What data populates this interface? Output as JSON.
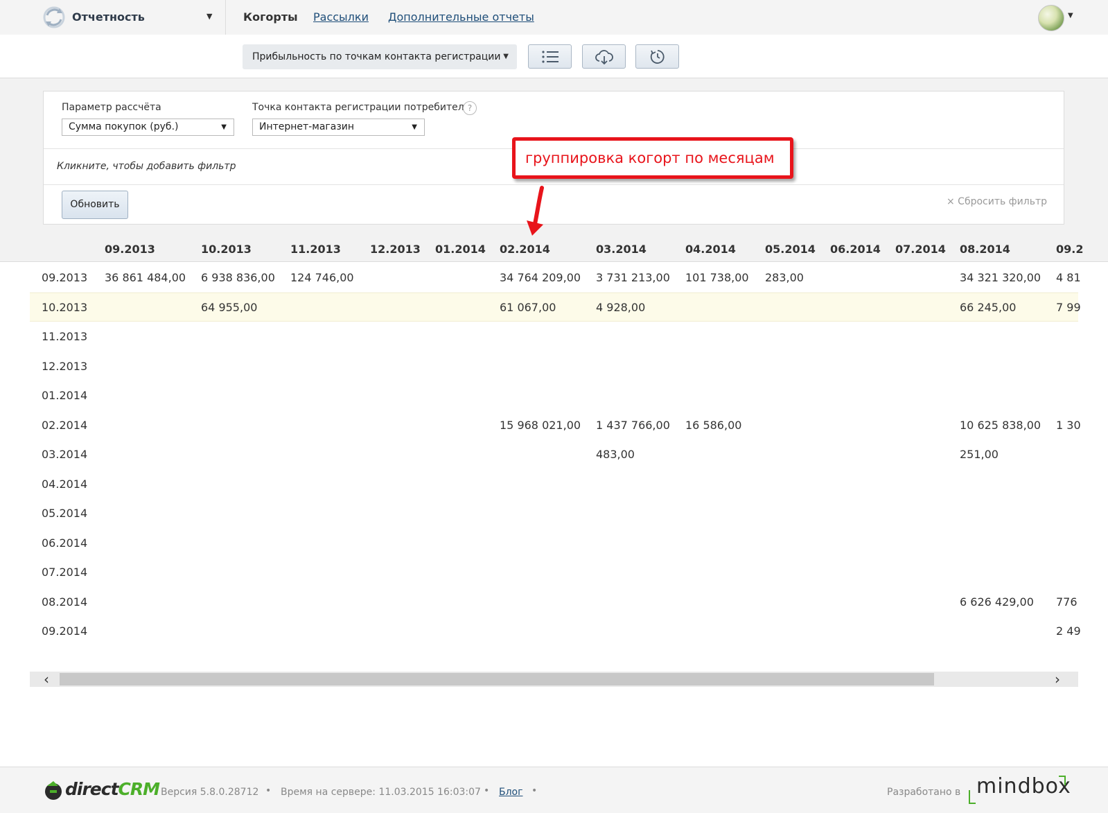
{
  "nav": {
    "section_title": "Отчетность",
    "active_tab": "Когорты",
    "links": [
      "Рассылки",
      "Дополнительные отчеты"
    ]
  },
  "toolbar": {
    "report_select": "Прибыльность по точкам контакта регистрации",
    "buttons": [
      "list-icon",
      "cloud-download-icon",
      "history-icon"
    ]
  },
  "filters": {
    "param_label": "Параметр рассчёта",
    "param_value": "Сумма покупок (руб.)",
    "point_label": "Точка контакта регистрации потребителя",
    "point_value": "Интернет-магазин",
    "help": "?",
    "add_filter": "Кликните, чтобы добавить фильтр",
    "update_label": "Обновить",
    "reset_label": "× Сбросить фильтр"
  },
  "annotation": {
    "text": "группировка когорт по месяцам",
    "color": "#e8141b"
  },
  "table": {
    "columns": [
      "09.2013",
      "10.2013",
      "11.2013",
      "12.2013",
      "01.2014",
      "02.2014",
      "03.2014",
      "04.2014",
      "05.2014",
      "06.2014",
      "07.2014",
      "08.2014",
      "09.2"
    ],
    "rows": [
      {
        "label": "09.2013",
        "cells": [
          "36 861 484,00",
          "6 938 836,00",
          "124 746,00",
          "",
          "",
          "34 764 209,00",
          "3 731 213,00",
          "101 738,00",
          "283,00",
          "",
          "",
          "34 321 320,00",
          "4 81"
        ]
      },
      {
        "label": "10.2013",
        "cells": [
          "",
          "64 955,00",
          "",
          "",
          "",
          "61 067,00",
          "4 928,00",
          "",
          "",
          "",
          "",
          "66 245,00",
          "7 99"
        ]
      },
      {
        "label": "11.2013",
        "cells": [
          "",
          "",
          "",
          "",
          "",
          "",
          "",
          "",
          "",
          "",
          "",
          "",
          ""
        ]
      },
      {
        "label": "12.2013",
        "cells": [
          "",
          "",
          "",
          "",
          "",
          "",
          "",
          "",
          "",
          "",
          "",
          "",
          ""
        ]
      },
      {
        "label": "01.2014",
        "cells": [
          "",
          "",
          "",
          "",
          "",
          "",
          "",
          "",
          "",
          "",
          "",
          "",
          ""
        ]
      },
      {
        "label": "02.2014",
        "cells": [
          "",
          "",
          "",
          "",
          "",
          "15 968 021,00",
          "1 437 766,00",
          "16 586,00",
          "",
          "",
          "",
          "10 625 838,00",
          "1 30"
        ]
      },
      {
        "label": "03.2014",
        "cells": [
          "",
          "",
          "",
          "",
          "",
          "",
          "483,00",
          "",
          "",
          "",
          "",
          "251,00",
          ""
        ]
      },
      {
        "label": "04.2014",
        "cells": [
          "",
          "",
          "",
          "",
          "",
          "",
          "",
          "",
          "",
          "",
          "",
          "",
          ""
        ]
      },
      {
        "label": "05.2014",
        "cells": [
          "",
          "",
          "",
          "",
          "",
          "",
          "",
          "",
          "",
          "",
          "",
          "",
          ""
        ]
      },
      {
        "label": "06.2014",
        "cells": [
          "",
          "",
          "",
          "",
          "",
          "",
          "",
          "",
          "",
          "",
          "",
          "",
          ""
        ]
      },
      {
        "label": "07.2014",
        "cells": [
          "",
          "",
          "",
          "",
          "",
          "",
          "",
          "",
          "",
          "",
          "",
          "",
          ""
        ]
      },
      {
        "label": "08.2014",
        "cells": [
          "",
          "",
          "",
          "",
          "",
          "",
          "",
          "",
          "",
          "",
          "",
          "6 626 429,00",
          "776"
        ]
      },
      {
        "label": "09.2014",
        "cells": [
          "",
          "",
          "",
          "",
          "",
          "",
          "",
          "",
          "",
          "",
          "",
          "",
          "2 49"
        ]
      }
    ],
    "highlighted_row": 1
  },
  "footer": {
    "logo_direct": "direct",
    "logo_crm": "CRM",
    "version": "Версия 5.8.0.28712",
    "server_time": "Время на сервере: 11.03.2015 16:03:07",
    "blog": "Блог",
    "developed_by": "Разработано в",
    "mindbox": "mindbox"
  }
}
